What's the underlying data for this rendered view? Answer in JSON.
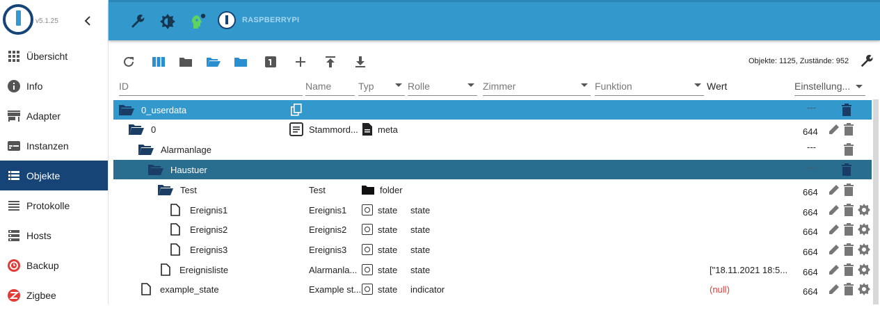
{
  "brand": {
    "version": "v5.1.25",
    "logo_icon": "iobroker-logo-icon"
  },
  "nav": [
    {
      "label": "Übersicht",
      "icon": "grid-icon"
    },
    {
      "label": "Info",
      "icon": "info-icon"
    },
    {
      "label": "Adapter",
      "icon": "store-icon"
    },
    {
      "label": "Instanzen",
      "icon": "instances-icon"
    },
    {
      "label": "Objekte",
      "icon": "list-icon",
      "active": true
    },
    {
      "label": "Protokolle",
      "icon": "log-icon"
    },
    {
      "label": "Hosts",
      "icon": "hosts-icon"
    },
    {
      "label": "Backup",
      "icon": "backup-icon"
    },
    {
      "label": "Zigbee",
      "icon": "zigbee-icon"
    }
  ],
  "header": {
    "host_name": "RASPBERRYPI"
  },
  "toolbar": {
    "stats": "Objekte: 1125, Zustände: 952"
  },
  "columns": {
    "id": "ID",
    "name": "Name",
    "typ": "Typ",
    "rolle": "Rolle",
    "zimmer": "Zimmer",
    "funktion": "Funktion",
    "wert": "Wert",
    "einstellungen": "Einstellung..."
  },
  "rows": [
    {
      "id": "0_userdata",
      "name": "",
      "type": "",
      "role": "",
      "value": "",
      "acl": "---"
    },
    {
      "id": "0",
      "name": "Stammord...",
      "type": "meta",
      "role": "",
      "value": "",
      "acl": "644"
    },
    {
      "id": "Alarmanlage",
      "name": "",
      "type": "",
      "role": "",
      "value": "",
      "acl": "---"
    },
    {
      "id": "Haustuer",
      "name": "",
      "type": "",
      "role": "",
      "value": "",
      "acl": "---"
    },
    {
      "id": "Test",
      "name": "Test",
      "type": "folder",
      "role": "",
      "value": "",
      "acl": "664"
    },
    {
      "id": "Ereignis1",
      "name": "Ereignis1",
      "type": "state",
      "role": "state",
      "value": "",
      "acl": "664"
    },
    {
      "id": "Ereignis2",
      "name": "Ereignis2",
      "type": "state",
      "role": "state",
      "value": "",
      "acl": "664"
    },
    {
      "id": "Ereignis3",
      "name": "Ereignis3",
      "type": "state",
      "role": "state",
      "value": "",
      "acl": "664"
    },
    {
      "id": "Ereignisliste",
      "name": "Alarmanla...",
      "type": "state",
      "role": "state",
      "value": "[\"18.11.2021 18:5...",
      "acl": "664"
    },
    {
      "id": "example_state",
      "name": "Example st...",
      "type": "state",
      "role": "indicator",
      "value": "(null)",
      "acl": "664"
    }
  ],
  "colors": {
    "header": "#3399cc",
    "brand_dark": "#164477",
    "row_selected": "#3399cc",
    "row_highlight": "#2a6e8f",
    "null_value": "#e53935"
  }
}
